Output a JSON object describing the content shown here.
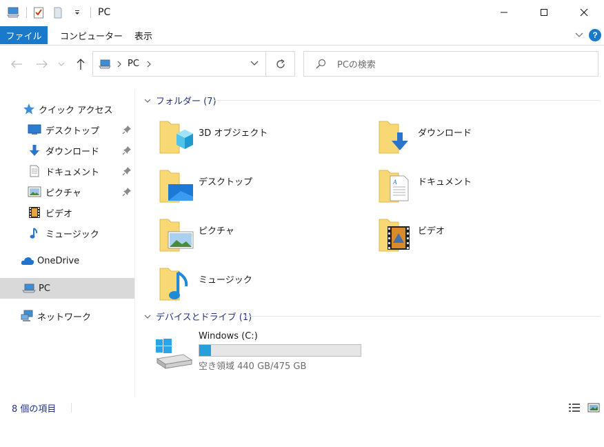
{
  "window": {
    "title": "PC",
    "minimize_icon": "minimize-icon",
    "maximize_icon": "maximize-icon",
    "close_icon": "close-icon"
  },
  "ribbon": {
    "file_tab": "ファイル",
    "tabs": [
      "コンピューター",
      "表示"
    ],
    "help": "?"
  },
  "nav": {
    "path": [
      "PC"
    ],
    "search_placeholder": "PCの検索"
  },
  "sidebar": {
    "quick_access": "クイック アクセス",
    "items": [
      {
        "label": "デスクトップ",
        "icon": "desktop-icon",
        "pinned": true
      },
      {
        "label": "ダウンロード",
        "icon": "download-icon",
        "pinned": true
      },
      {
        "label": "ドキュメント",
        "icon": "document-icon",
        "pinned": true
      },
      {
        "label": "ピクチャ",
        "icon": "picture-icon",
        "pinned": true
      },
      {
        "label": "ビデオ",
        "icon": "video-icon",
        "pinned": false
      },
      {
        "label": "ミュージック",
        "icon": "music-icon",
        "pinned": false
      }
    ],
    "onedrive": "OneDrive",
    "pc": "PC",
    "network": "ネットワーク"
  },
  "main": {
    "folders_header": "フォルダー (7)",
    "folders": [
      {
        "name": "3D オブジェクト",
        "icon": "3d-objects-folder-icon"
      },
      {
        "name": "ダウンロード",
        "icon": "downloads-folder-icon"
      },
      {
        "name": "デスクトップ",
        "icon": "desktop-folder-icon"
      },
      {
        "name": "ドキュメント",
        "icon": "documents-folder-icon"
      },
      {
        "name": "ピクチャ",
        "icon": "pictures-folder-icon"
      },
      {
        "name": "ビデオ",
        "icon": "videos-folder-icon"
      },
      {
        "name": "ミュージック",
        "icon": "music-folder-icon"
      }
    ],
    "devices_header": "デバイスとドライブ (1)",
    "drive": {
      "name": "Windows (C:)",
      "free_text": "空き領域 440 GB/475 GB",
      "used_fraction": 0.074
    }
  },
  "status": {
    "item_count": "8 個の項目"
  },
  "colors": {
    "accent": "#1979ca",
    "header_text": "#1e3287",
    "folder_yellow": "#f8d775",
    "drive_bar": "#26a0da"
  }
}
